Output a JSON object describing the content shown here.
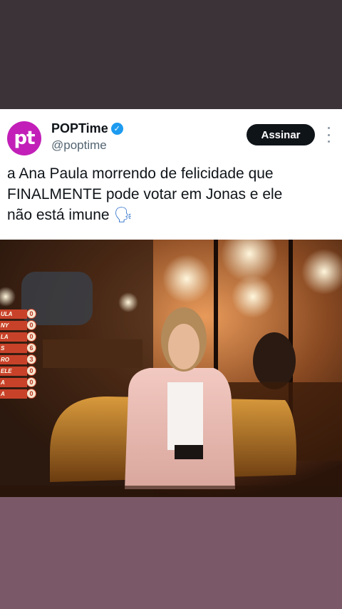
{
  "tweet": {
    "author_name": "POPTime",
    "author_handle": "@poptime",
    "avatar_text": "pt",
    "verified": true,
    "subscribe_label": "Assinar",
    "text_line1": "a Ana Paula morrendo de felicidade que",
    "text_line2": "FINALMENTE pode votar em Jonas e ele",
    "text_line3": "não está imune",
    "emoji": "🗣"
  },
  "scoreboard": [
    {
      "name": "ULA",
      "score": "0"
    },
    {
      "name": "NY",
      "score": "0"
    },
    {
      "name": "LA",
      "score": "0"
    },
    {
      "name": "S",
      "score": "6"
    },
    {
      "name": "RO",
      "score": "3"
    },
    {
      "name": "ELE",
      "score": "0"
    },
    {
      "name": "A",
      "score": "0"
    },
    {
      "name": "A",
      "score": "0"
    }
  ],
  "colors": {
    "brand": "#c21fb8",
    "verified": "#1d9bf0",
    "scoreboard_bar": "#c8422a"
  },
  "icons": {
    "verified": "verified-badge-icon",
    "more": "more-options-icon"
  }
}
